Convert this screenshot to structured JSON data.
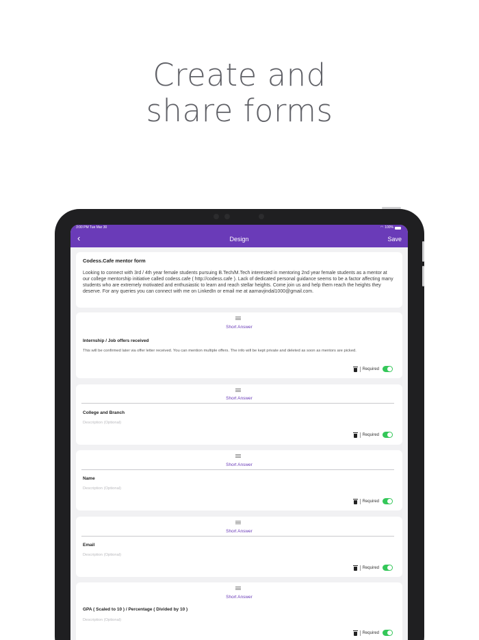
{
  "headline": {
    "line1": "Create and",
    "line2": "share forms"
  },
  "statusbar": {
    "time": "3:00 PM  Tue Mar 30",
    "battery": "100%"
  },
  "navbar": {
    "back_icon": "chevron-left-icon",
    "title": "Design",
    "save_label": "Save"
  },
  "form": {
    "title": "Codess.Cafe mentor form",
    "description": "Looking to connect with 3rd / 4th year female students pursuing B.Tech/M.Tech interested in mentoring 2nd year female students as a mentor at our college mentorship initiative called codess.cafe ( http://codess.cafe ). Lack of dedicated personal guidance seems to be a factor affecting many students who are extremely motivated and enthusiastic to learn and reach stellar heights. Come join us and help them reach the heights they deserve. For any queries you can connect with me on LinkedIn or email me at aarnavjindal1000@gmail.com."
  },
  "questions": [
    {
      "type": "Short Answer",
      "title": "Internship / Job offers received",
      "description": "This will be confirmed later via offer letter received. You can mention multiple offers. The info will be kept private and deleted as soon as mentors are picked.",
      "required_label": "Required",
      "required": true
    },
    {
      "type": "Short Answer",
      "title": "College and Branch",
      "description": "Description (Optional)",
      "required_label": "Required",
      "required": true
    },
    {
      "type": "Short Answer",
      "title": "Name",
      "description": "Description (Optional)",
      "required_label": "Required",
      "required": true
    },
    {
      "type": "Short Answer",
      "title": "Email",
      "description": "Description (Optional)",
      "required_label": "Required",
      "required": true
    },
    {
      "type": "Short Answer",
      "title": "GPA ( Scaled to 10 ) / Percentage ( Divided by 10 )",
      "description": "Description (Optional)",
      "required_label": "Required",
      "required": true
    }
  ],
  "colors": {
    "accent": "#6a3bb8",
    "toggle_on": "#34c759",
    "headline": "#5f6066"
  }
}
